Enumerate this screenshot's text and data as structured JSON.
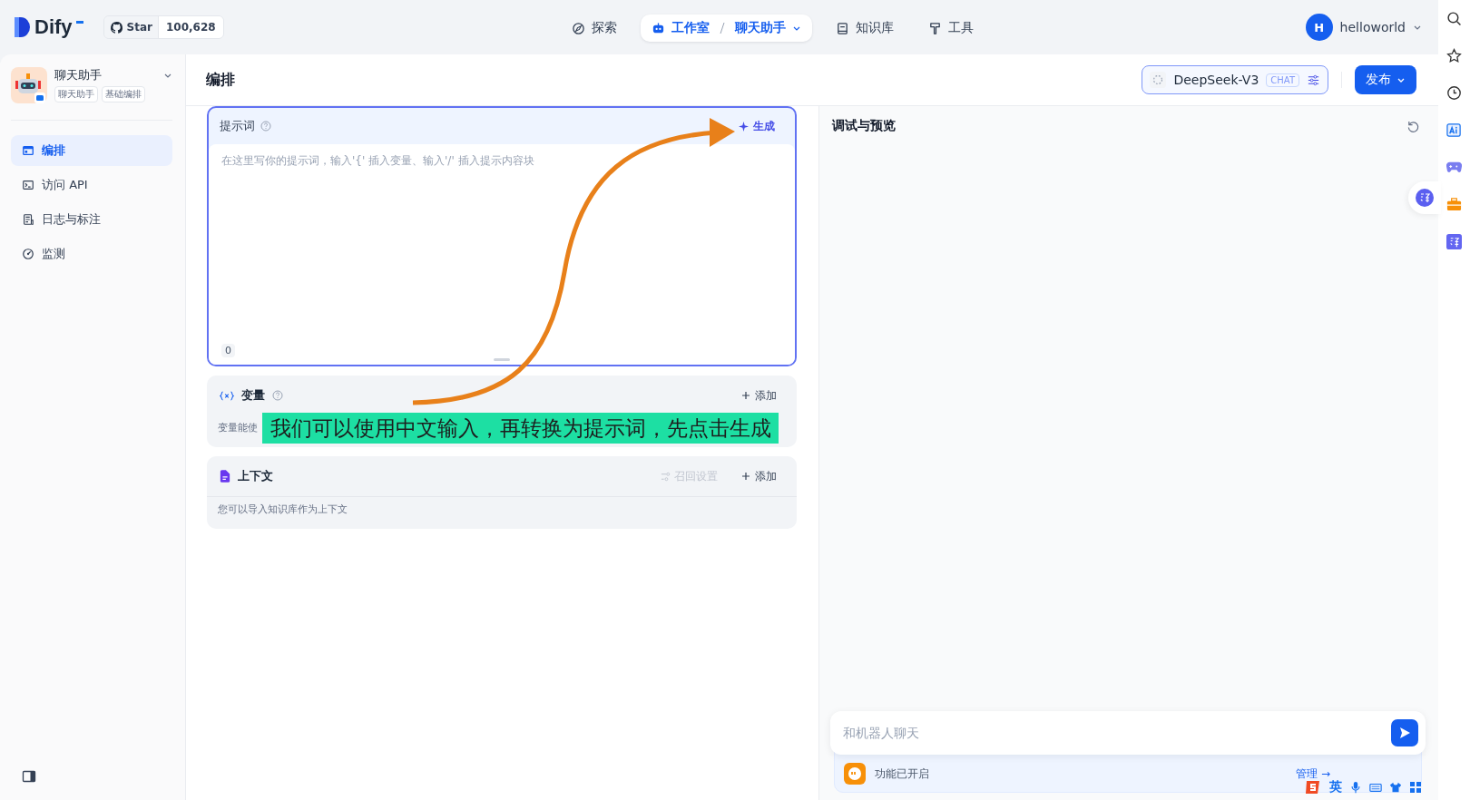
{
  "nav": {
    "logo": "Dify",
    "github": {
      "label": "Star",
      "count": "100,628"
    },
    "tabs": [
      {
        "label": "探索",
        "selected": false
      },
      {
        "label": "工作室",
        "selected": true,
        "sub": "聊天助手"
      },
      {
        "label": "知识库",
        "selected": false
      },
      {
        "label": "工具",
        "selected": false
      }
    ],
    "user": {
      "initial": "H",
      "name": "helloworld"
    }
  },
  "app": {
    "name": "聊天助手",
    "tags": [
      "聊天助手",
      "基础编排"
    ]
  },
  "sidebar": {
    "items": [
      {
        "label": "编排",
        "selected": true
      },
      {
        "label": "访问 API",
        "selected": false
      },
      {
        "label": "日志与标注",
        "selected": false
      },
      {
        "label": "监测",
        "selected": false
      }
    ]
  },
  "page_title": "编排",
  "model": {
    "name": "DeepSeek-V3",
    "badge": "CHAT"
  },
  "publish_button": "发布",
  "prompt": {
    "title": "提示词",
    "generate": "生成",
    "placeholder": "在这里写你的提示词，输入'{' 插入变量、输入'/' 插入提示内容块",
    "count": "0"
  },
  "variables": {
    "title": "变量",
    "add": "添加",
    "description": "变量能使"
  },
  "context": {
    "title": "上下文",
    "settings": {
      "label": "召回设置",
      "disabled": true
    },
    "add": "添加",
    "description": "您可以导入知识库作为上下文"
  },
  "preview": {
    "title": "调试与预览",
    "chat_placeholder": "和机器人聊天",
    "feature_note": "功能已开启",
    "manage": "管理 →"
  },
  "annotation": {
    "caption": "我们可以使用中文输入，再转换为提示词，先点击生成"
  },
  "ime_toolbar": {
    "language": "英"
  }
}
